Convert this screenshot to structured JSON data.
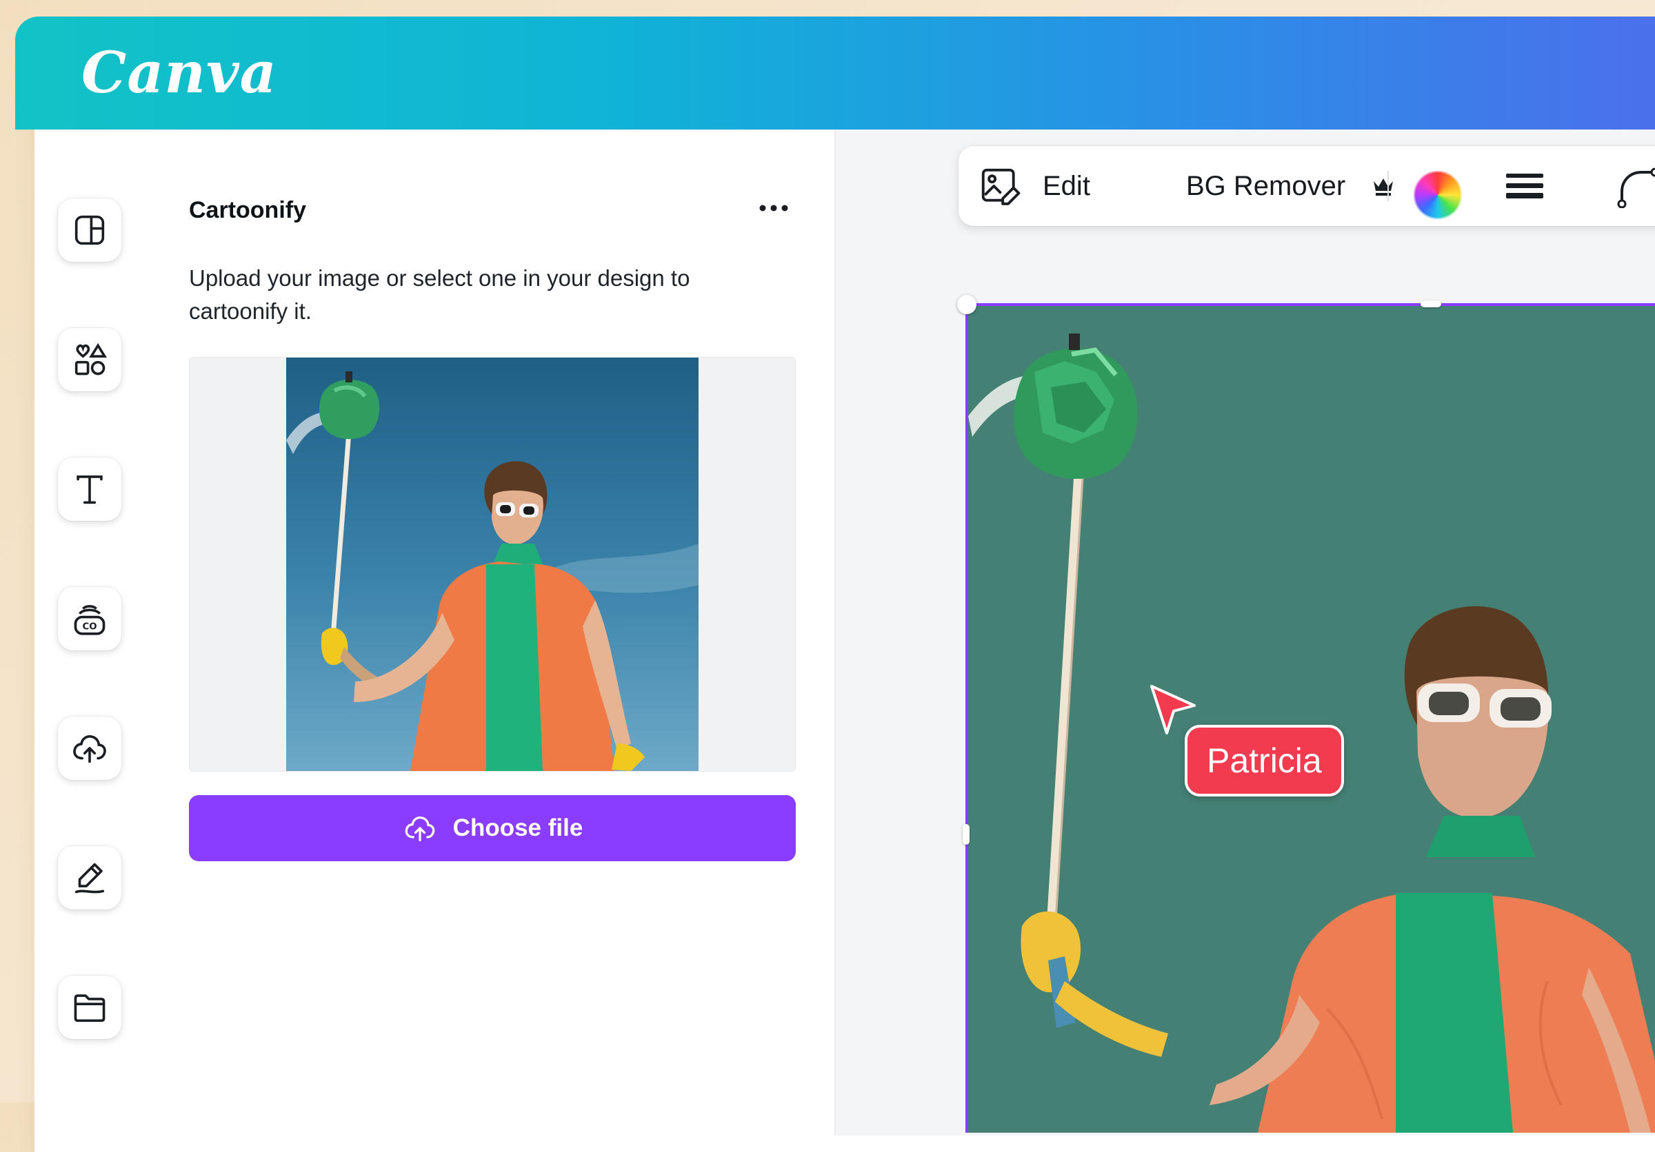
{
  "app": {
    "brand": "Canva",
    "brand_color": "#12c3c6",
    "accent_color": "#8b3dff"
  },
  "rail": {
    "items": [
      {
        "icon": "layout-icon"
      },
      {
        "icon": "elements-icon"
      },
      {
        "icon": "text-icon"
      },
      {
        "icon": "brand-icon"
      },
      {
        "icon": "upload-cloud-icon"
      },
      {
        "icon": "draw-icon"
      },
      {
        "icon": "folder-icon"
      }
    ]
  },
  "panel": {
    "title": "Cartoonify",
    "more_icon": "more-horizontal-icon",
    "description": "Upload your image or select one in your design to cartoonify it.",
    "choose_button": "Choose file",
    "choose_icon": "upload-cloud-icon"
  },
  "toolbar": {
    "edit_icon": "image-edit-icon",
    "edit_label": "Edit",
    "bg_remover_label": "BG Remover",
    "pro_icon": "crown-icon",
    "color_icon": "color-wheel-icon",
    "lines_icon": "line-weight-icon",
    "corner_icon": "corner-radius-icon"
  },
  "canvas": {
    "collaborator_name": "Patricia",
    "collaborator_color": "#f23b4e"
  }
}
